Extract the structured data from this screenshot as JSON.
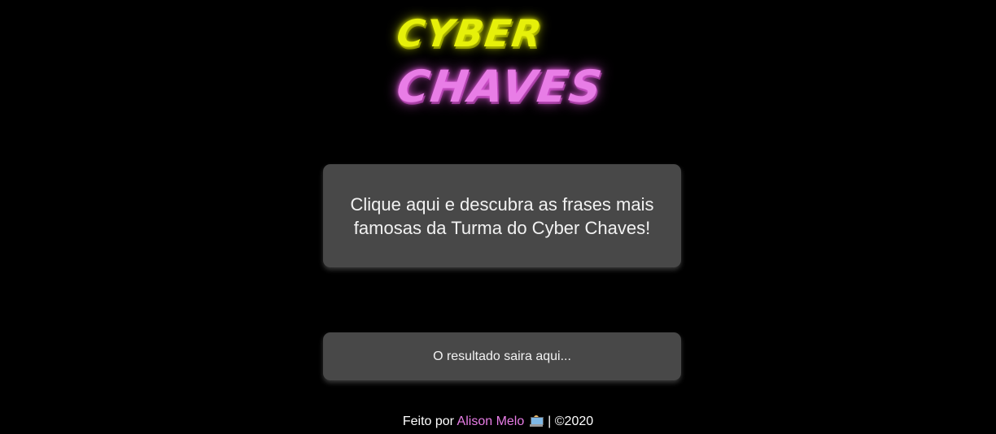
{
  "logo": {
    "line1": "CYBER",
    "line2": "CHAVES",
    "colors": {
      "line1": "#e6f00a",
      "line2": "#e87de6"
    }
  },
  "quote_button": {
    "label": "Clique aqui e descubra as frases mais famosas da Turma do Cyber Chaves!"
  },
  "result": {
    "text": "O resultado saira aqui..."
  },
  "footer": {
    "prefix": "Feito por",
    "author": "Alison Melo",
    "emoji_icon": "technologist-emoji-icon",
    "suffix": "| ©2020",
    "author_color": "#e87de6"
  },
  "colors": {
    "background": "#000000",
    "card": "#484848",
    "text": "#f2f2f2"
  }
}
